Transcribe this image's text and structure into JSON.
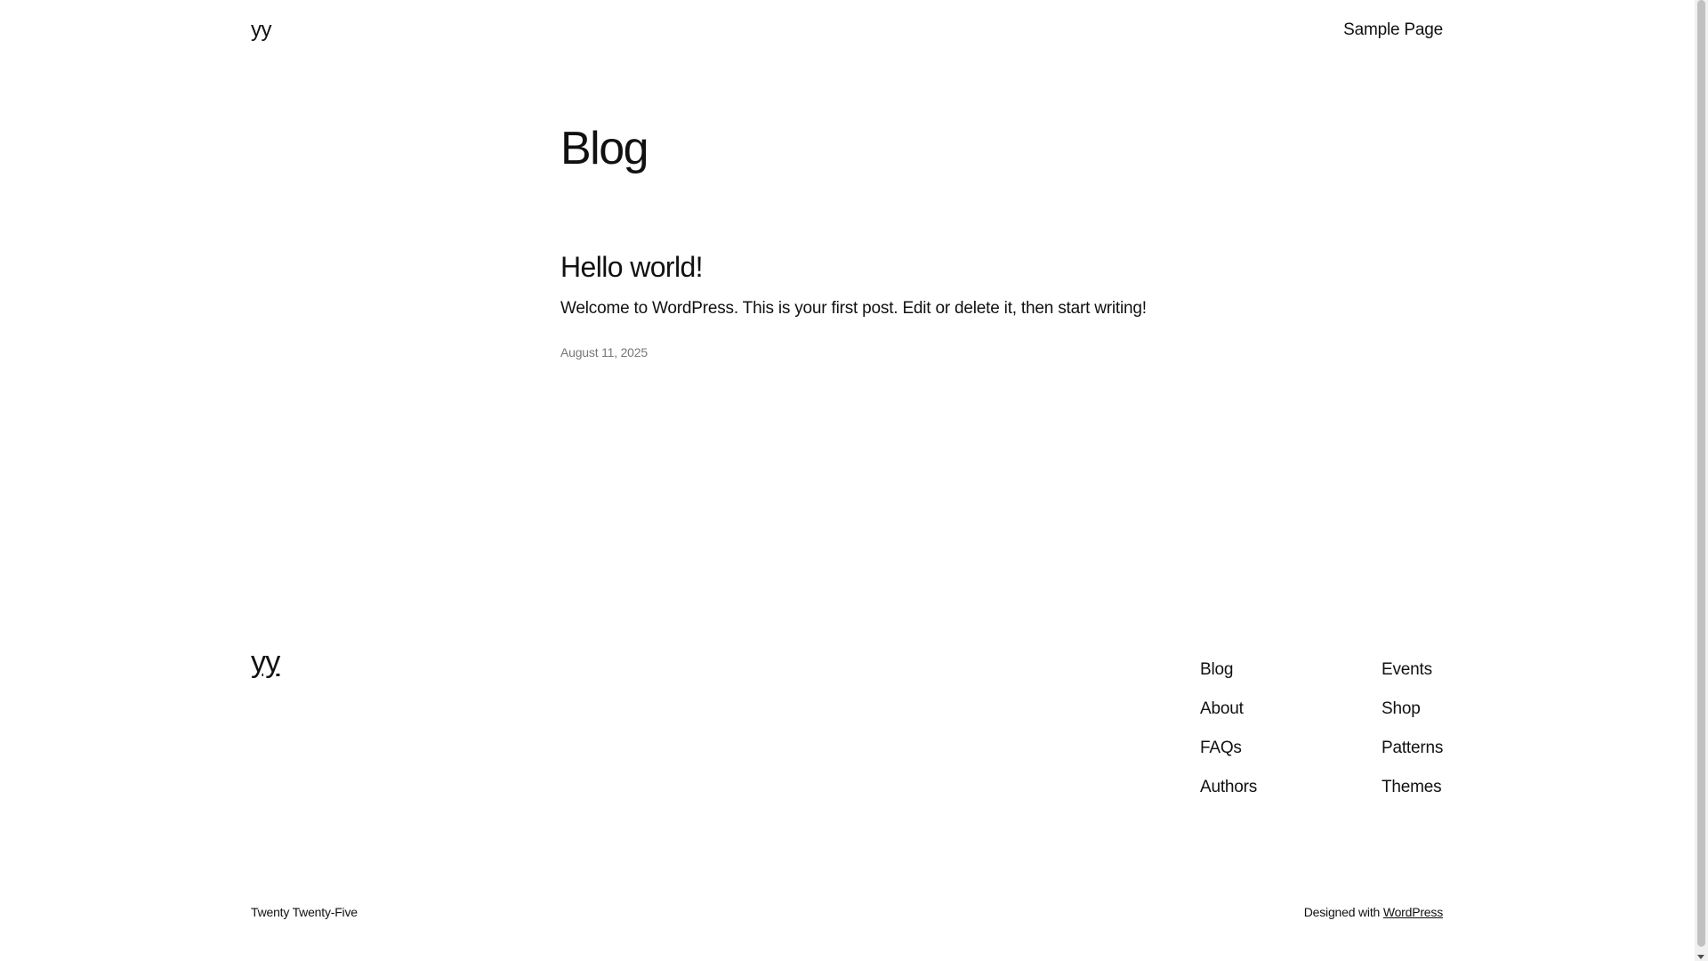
{
  "header": {
    "site_title": "yy",
    "nav": [
      "Sample Page"
    ]
  },
  "main": {
    "heading": "Blog",
    "posts": [
      {
        "title": "Hello world!",
        "excerpt": "Welcome to WordPress. This is your first post. Edit or delete it, then start writing!",
        "date": "August 11, 2025"
      }
    ]
  },
  "footer": {
    "site_title": "yy",
    "nav_col1": [
      "Blog",
      "About",
      "FAQs",
      "Authors"
    ],
    "nav_col2": [
      "Events",
      "Shop",
      "Patterns",
      "Themes"
    ],
    "theme_name": "Twenty Twenty-Five",
    "credit_prefix": "Designed with",
    "credit_link": "WordPress"
  }
}
